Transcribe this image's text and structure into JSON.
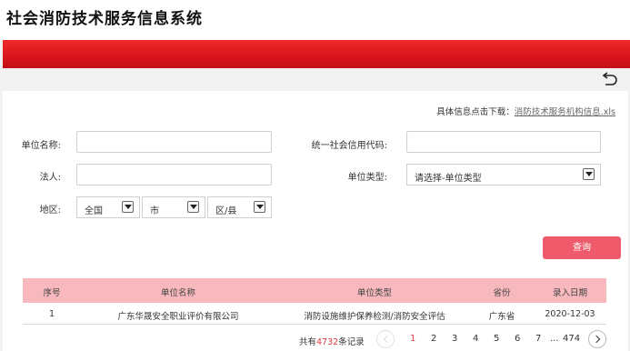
{
  "header": {
    "title": "社会消防技术服务信息系统"
  },
  "download": {
    "prefix": "具体信息点击下载：",
    "link_text": "消防技术服务机构信息.xls"
  },
  "form": {
    "unit_name_label": "单位名称:",
    "credit_code_label": "统一社会信用代码:",
    "legal_person_label": "法人:",
    "unit_type_label": "单位类型:",
    "unit_type_value": "请选择-单位类型",
    "region_label": "地区:",
    "region_country": "全国",
    "region_city": "市",
    "region_county": "区/县",
    "unit_name_value": "",
    "credit_code_value": "",
    "legal_person_value": ""
  },
  "query_button": "查询",
  "table": {
    "headers": [
      "序号",
      "单位名称",
      "单位类型",
      "省份",
      "录入日期"
    ],
    "rows": [
      [
        "1",
        "广东华晟安全职业评价有限公司",
        "消防设施维护保养检测/消防安全评估",
        "广东省",
        "2020-12-03"
      ]
    ]
  },
  "pagination": {
    "total_prefix": "共有",
    "total_count": "4732",
    "total_suffix": "条记录",
    "pages": [
      "1",
      "2",
      "3",
      "4",
      "5",
      "6",
      "7"
    ],
    "ellipsis": "...",
    "last_page": "474",
    "current_page": "1"
  },
  "colors": {
    "brand_red": "#d8141c",
    "query_button": "#ef5b6a",
    "table_header": "#f7b9bd"
  },
  "icons": {
    "back": "undo-arrow-icon"
  }
}
